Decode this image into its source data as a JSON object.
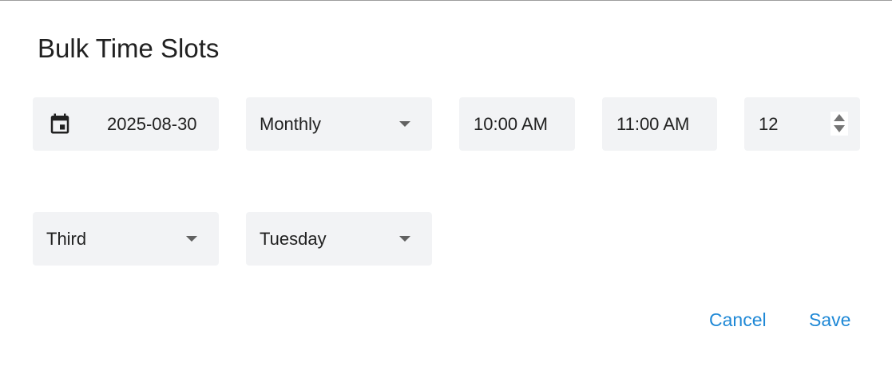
{
  "dialog": {
    "title": "Bulk Time Slots"
  },
  "form": {
    "start_date": "2025-08-30",
    "repeat": "Monthly",
    "start_time": "10:00 AM",
    "end_time": "11:00 AM",
    "occurrences": "12",
    "ordinal": "Third",
    "weekday": "Tuesday"
  },
  "icons": {
    "date": "calendar-icon",
    "dropdown": "caret-down-icon",
    "spinner": "spinner-arrows-icon"
  },
  "actions": {
    "cancel_label": "Cancel",
    "save_label": "Save"
  },
  "colors": {
    "accent": "#1e88d6",
    "field_background": "#f2f3f5",
    "text": "#212121"
  }
}
